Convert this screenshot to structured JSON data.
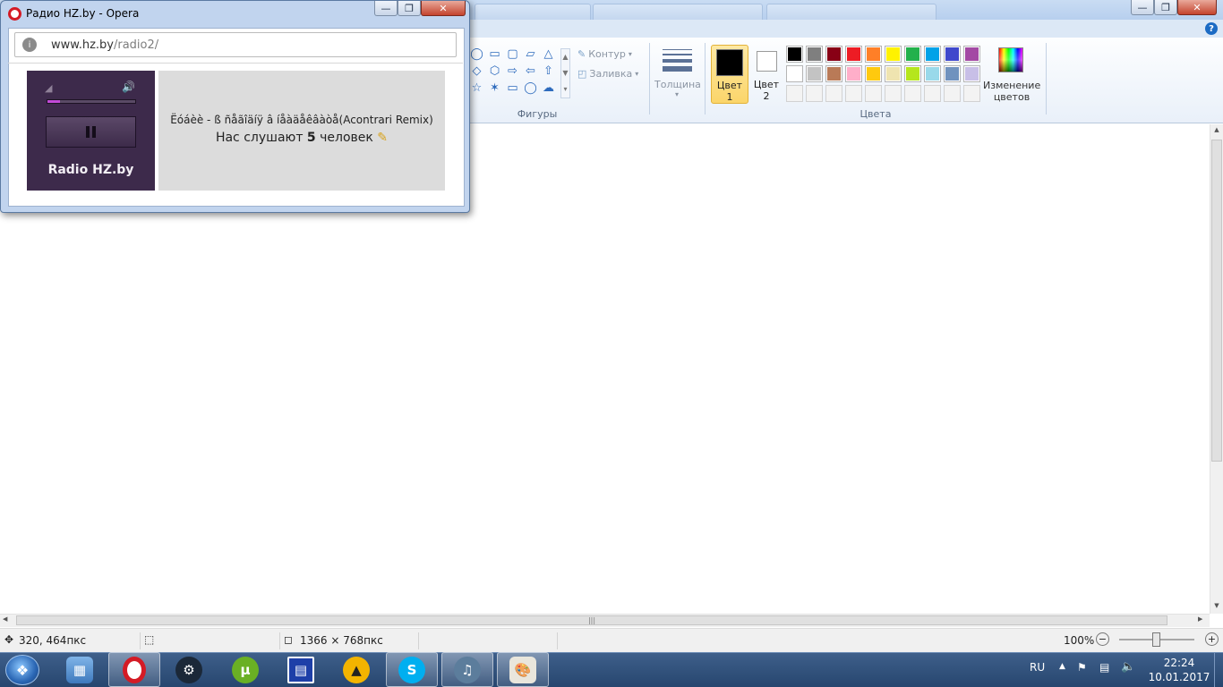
{
  "paint": {
    "ribbon": {
      "contour_label": "Контур",
      "fill_label": "Заливка",
      "shapes_group": "Фигуры",
      "thickness_label": "Толщина",
      "color1_label": "Цвет\n1",
      "color2_label": "Цвет\n2",
      "colors_group": "Цвета",
      "edit_colors_label": "Изменение\nцветов",
      "color1": "#000000",
      "color2": "#ffffff",
      "palette_row1": [
        "#000000",
        "#7f7f7f",
        "#880015",
        "#ed1c24",
        "#ff7f27",
        "#fff200",
        "#22b14c",
        "#00a2e8",
        "#3f48cc",
        "#a349a4"
      ],
      "palette_row2": [
        "#ffffff",
        "#c3c3c3",
        "#b97a57",
        "#ffaec9",
        "#ffc90e",
        "#efe4b0",
        "#b5e61d",
        "#99d9ea",
        "#7092be",
        "#c8bfe7"
      ]
    },
    "status": {
      "cursor_pos": "320, 464пкс",
      "image_size": "1366 × 768пкс",
      "zoom": "100%"
    }
  },
  "opera": {
    "title": "Радио HZ.by - Opera",
    "url_host": "www.hz.by",
    "url_path": "/radio2/",
    "player": {
      "station_name": "Radio HZ.by",
      "volume_level": 0.14,
      "track_title": "Ëóáèè - ß ñåãîäíÿ â íåàäåêâàòå(Acontrari Remix)",
      "listeners_prefix": "Нас слушают",
      "listeners_count": "5",
      "listeners_suffix": "человек"
    }
  },
  "taskbar": {
    "language": "RU",
    "time": "22:24",
    "date": "10.01.2017",
    "apps": [
      "windows-explorer",
      "opera",
      "steam",
      "utorrent",
      "save-app",
      "aimp",
      "skype",
      "sound-app",
      "paint"
    ]
  }
}
